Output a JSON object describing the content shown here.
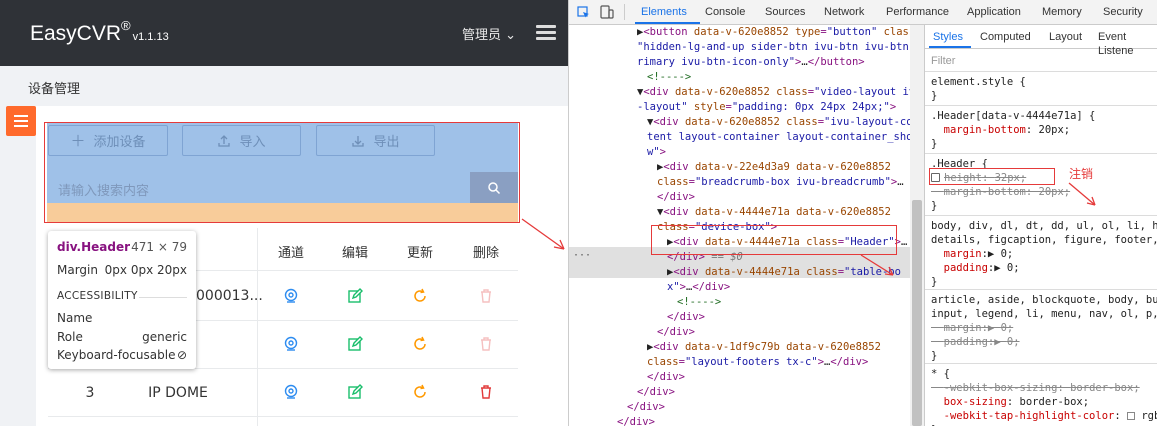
{
  "app": {
    "brand": "EasyCVR",
    "brand_mark": "®",
    "version": "v1.1.13",
    "user": "管理员",
    "breadcrumb": "设备管理",
    "toolbar": {
      "add": "添加设备",
      "import": "导入",
      "export": "导出"
    },
    "search": {
      "placeholder": "请输入搜索内容"
    },
    "columns": {
      "name_partial": "称",
      "channel": "通道",
      "edit": "编辑",
      "update": "更新",
      "delete": "删除"
    },
    "rows": [
      {
        "name": "000013..."
      },
      {
        "name": ""
      },
      {
        "index": "3",
        "name": "IP DOME"
      }
    ]
  },
  "tooltip": {
    "name": "div.Header",
    "size": "471 × 79",
    "margin_label": "Margin",
    "margin_value": "0px 0px 20px",
    "section": "ACCESSIBILITY",
    "name_label": "Name",
    "role_label": "Role",
    "role_value": "generic",
    "focus_label": "Keyboard-focusable"
  },
  "devtools": {
    "tabs": [
      "Elements",
      "Console",
      "Sources",
      "Network",
      "Performance",
      "Application",
      "Memory",
      "Security"
    ],
    "styles_tabs": [
      "Styles",
      "Computed",
      "Layout",
      "Event Listene"
    ],
    "filter": "Filter",
    "annotation": "注销"
  },
  "colors": {
    "topbar": "#2f3237",
    "side_button": "#ff6a2c",
    "highlight_content": "#9fc1e8",
    "highlight_margin": "#f8cc9a",
    "annotation": "#e53a3a"
  }
}
